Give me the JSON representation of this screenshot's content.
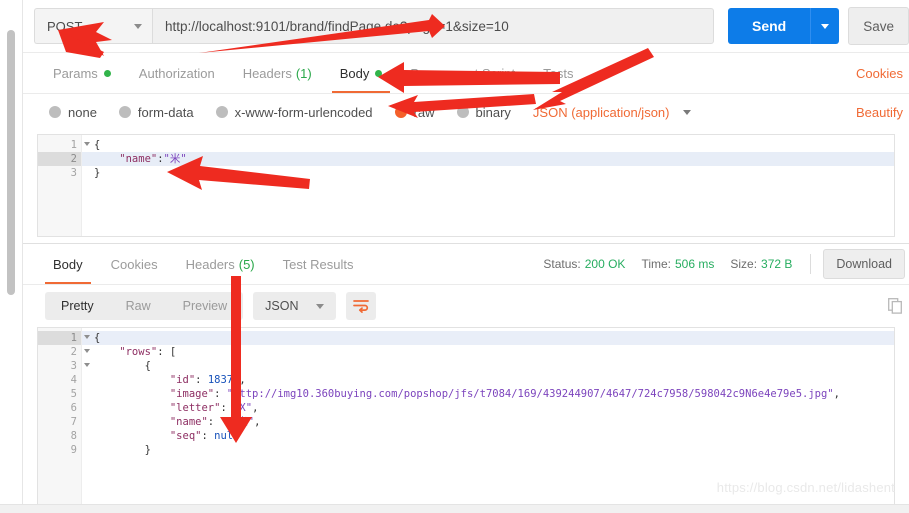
{
  "request": {
    "method": "POST",
    "url": "http://localhost:9101/brand/findPage.do?page=1&size=10",
    "send_label": "Send",
    "save_label": "Save",
    "tabs": [
      {
        "label": "Params",
        "dot": true,
        "active": false
      },
      {
        "label": "Authorization",
        "dot": false,
        "active": false
      },
      {
        "label": "Headers",
        "count": "(1)",
        "dot": false,
        "active": false
      },
      {
        "label": "Body",
        "dot": true,
        "active": true
      },
      {
        "label": "Pre-request Script",
        "dot": false,
        "active": false
      },
      {
        "label": "Tests",
        "dot": false,
        "active": false
      }
    ],
    "cookies_link": "Cookies",
    "body_types": [
      {
        "label": "none",
        "selected": false
      },
      {
        "label": "form-data",
        "selected": false
      },
      {
        "label": "x-www-form-urlencoded",
        "selected": false
      },
      {
        "label": "raw",
        "selected": true
      },
      {
        "label": "binary",
        "selected": false
      }
    ],
    "content_type": "JSON (application/json)",
    "beautify_link": "Beautify",
    "editor": {
      "selected_line": 2,
      "lines": [
        {
          "n": "1",
          "fold": true,
          "tokens": [
            {
              "t": "{",
              "c": "tok-punc"
            }
          ]
        },
        {
          "n": "2",
          "fold": false,
          "tokens": [
            {
              "t": "    \"name\"",
              "c": "tok-key"
            },
            {
              "t": ":",
              "c": "tok-punc"
            },
            {
              "t": "\"米\"",
              "c": "tok-str"
            }
          ]
        },
        {
          "n": "3",
          "fold": false,
          "tokens": [
            {
              "t": "}",
              "c": "tok-punc"
            }
          ]
        }
      ]
    }
  },
  "response": {
    "tabs": [
      {
        "label": "Body",
        "active": true
      },
      {
        "label": "Cookies",
        "active": false
      },
      {
        "label": "Headers",
        "count": "(5)",
        "active": false
      },
      {
        "label": "Test Results",
        "active": false
      }
    ],
    "status_label": "Status:",
    "status_value": "200 OK",
    "time_label": "Time:",
    "time_value": "506 ms",
    "size_label": "Size:",
    "size_value": "372 B",
    "download_label": "Download",
    "view_modes": [
      {
        "label": "Pretty",
        "active": true
      },
      {
        "label": "Raw",
        "active": false
      },
      {
        "label": "Preview",
        "active": false
      }
    ],
    "format": "JSON",
    "editor": {
      "selected_line": 1,
      "lines": [
        {
          "n": "1",
          "fold": true,
          "tokens": [
            {
              "t": "{",
              "c": "tok-punc"
            }
          ]
        },
        {
          "n": "2",
          "fold": true,
          "tokens": [
            {
              "t": "    \"rows\"",
              "c": "tok-key"
            },
            {
              "t": ": [",
              "c": "tok-punc"
            }
          ]
        },
        {
          "n": "3",
          "fold": true,
          "tokens": [
            {
              "t": "        {",
              "c": "tok-punc"
            }
          ]
        },
        {
          "n": "4",
          "fold": false,
          "tokens": [
            {
              "t": "            \"id\"",
              "c": "tok-key"
            },
            {
              "t": ": ",
              "c": "tok-punc"
            },
            {
              "t": "18374",
              "c": "tok-num"
            },
            {
              "t": ",",
              "c": "tok-punc"
            }
          ]
        },
        {
          "n": "5",
          "fold": false,
          "tokens": [
            {
              "t": "            \"image\"",
              "c": "tok-key"
            },
            {
              "t": ": ",
              "c": "tok-punc"
            },
            {
              "t": "\"http://img10.360buying.com/popshop/jfs/t7084/169/439244907/4647/724c7958/598042c9N6e4e79e5.jpg\"",
              "c": "tok-str"
            },
            {
              "t": ",",
              "c": "tok-punc"
            }
          ]
        },
        {
          "n": "6",
          "fold": false,
          "tokens": [
            {
              "t": "            \"letter\"",
              "c": "tok-key"
            },
            {
              "t": ": ",
              "c": "tok-punc"
            },
            {
              "t": "\"X\"",
              "c": "tok-str"
            },
            {
              "t": ",",
              "c": "tok-punc"
            }
          ]
        },
        {
          "n": "7",
          "fold": false,
          "tokens": [
            {
              "t": "            \"name\"",
              "c": "tok-key"
            },
            {
              "t": ": ",
              "c": "tok-punc"
            },
            {
              "t": "\"小米\"",
              "c": "tok-str"
            },
            {
              "t": ",",
              "c": "tok-punc"
            }
          ]
        },
        {
          "n": "8",
          "fold": false,
          "tokens": [
            {
              "t": "            \"seq\"",
              "c": "tok-key"
            },
            {
              "t": ": ",
              "c": "tok-punc"
            },
            {
              "t": "null",
              "c": "tok-null"
            }
          ]
        },
        {
          "n": "9",
          "fold": false,
          "tokens": [
            {
              "t": "        }",
              "c": "tok-punc"
            }
          ]
        }
      ]
    }
  },
  "watermark": "https://blog.csdn.net/lidashent",
  "colors": {
    "send_blue": "#0d7ce8",
    "accent_orange": "#f06a35",
    "status_green": "#27ad60",
    "dot_green": "#32b44a",
    "arrow_red": "#ee2b20"
  },
  "annotations": {
    "arrows": [
      {
        "name": "arrow-to-method",
        "points": "to POST method selector"
      },
      {
        "name": "arrow-to-url",
        "points": "to URL input field"
      },
      {
        "name": "arrow-to-body-tab",
        "points": "to Body request tab"
      },
      {
        "name": "arrow-to-raw-radio",
        "points": "to raw body-type radio"
      },
      {
        "name": "arrow-to-json-type",
        "points": "to JSON (application/json) selector"
      },
      {
        "name": "arrow-to-request-json",
        "points": "to request body JSON line 2"
      },
      {
        "name": "arrow-to-response-json",
        "points": "to response body JSON"
      }
    ]
  }
}
